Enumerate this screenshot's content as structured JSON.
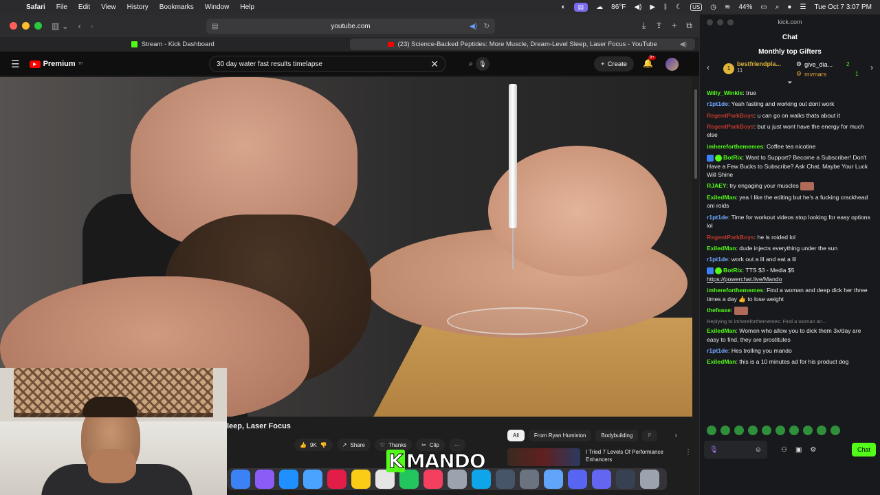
{
  "menubar": {
    "app": "Safari",
    "items": [
      "File",
      "Edit",
      "View",
      "History",
      "Bookmarks",
      "Window",
      "Help"
    ],
    "weather": "86°F",
    "input_source": "US",
    "battery": "44%",
    "datetime": "Tue Oct 7  3:07 PM"
  },
  "safari": {
    "address": "youtube.com",
    "tabs": [
      {
        "label": "Stream - Kick Dashboard"
      },
      {
        "label": "(23) Science-Backed Peptides: More Muscle, Dream-Level Sleep, Laser Focus - YouTube"
      }
    ]
  },
  "youtube": {
    "logo": "Premium",
    "logo_sup": "TH",
    "search_value": "30 day water fast results timelapse",
    "create_label": "Create",
    "notif_badge": "9+",
    "video_title_visible": "leep, Laser Focus",
    "actions": {
      "likes": "9K",
      "share": "Share",
      "thanks": "Thanks",
      "clip": "Clip"
    },
    "chips": [
      "All",
      "From Ryan Humiston",
      "Bodybuilding",
      "P"
    ],
    "rec_title": "I Tried 7 Levels Of Performance Enhancers"
  },
  "overlay": {
    "k": "K",
    "rest": "MANDO"
  },
  "kick": {
    "window_title": "kick.com",
    "header": "Chat",
    "gifters_title": "Monthly top Gifters",
    "top_gifter": {
      "rank": "1",
      "name": "bestfriendpla...",
      "count": "11"
    },
    "gifter2": {
      "name": "give_dia...",
      "count": "2"
    },
    "gifter3": {
      "name": "mvmars",
      "count": "1"
    },
    "messages": [
      {
        "user": "Willy_Winkle",
        "color": "#53fc18",
        "text": "true"
      },
      {
        "user": "r1pt1de",
        "color": "#6fa8ff",
        "text": "Yeah fasting and working out dont work"
      },
      {
        "user": "RegentParkBoys",
        "color": "#c0392b",
        "text": "u can go on walks thats about it"
      },
      {
        "user": "RegentParkBoys",
        "color": "#c0392b",
        "text": "but u just wont have the energy for much else"
      },
      {
        "user": "imhereforthememes",
        "color": "#53fc18",
        "text": "Coffee tea nicotine"
      },
      {
        "user": "BotRix",
        "color": "#53fc18",
        "text": "Want to Support? Become a Subscriber! Don't Have a Few Bucks to Subscribe? Ask Chat, Maybe Your Luck Will Shine"
      },
      {
        "user": "RJAEY",
        "color": "#53fc18",
        "text": "try engaging your muscles"
      },
      {
        "user": "ExiledMan",
        "color": "#53fc18",
        "text": "yea I like the editing but he's a fucking crackhead oni roids"
      },
      {
        "user": "r1pt1de",
        "color": "#6fa8ff",
        "text": "Time for workout videos stop looking for easy options lol"
      },
      {
        "user": "RegentParkBoys",
        "color": "#c0392b",
        "text": "he is roided lol"
      },
      {
        "user": "ExiledMan",
        "color": "#53fc18",
        "text": "dude injects everything under the sun"
      },
      {
        "user": "r1pt1de",
        "color": "#6fa8ff",
        "text": "work out a lil and eat a lil"
      },
      {
        "user": "BotRix",
        "color": "#53fc18",
        "text": "TTS $3 - Media $5",
        "link": "https://powerchat.live/Mando"
      },
      {
        "user": "imhereforthememes",
        "color": "#53fc18",
        "text": "Find a woman and deep dick her three times a day 👍 to lose weight"
      },
      {
        "user": "thefease",
        "color": "#53fc18",
        "text": ""
      },
      {
        "reply": "Replying to imhereforthememes: Find a woman an...",
        "user": "ExiledMan",
        "color": "#53fc18",
        "text": "Women who allow you to dick them 3x/day are easy to find, they are prostitutes"
      },
      {
        "user": "r1pt1de",
        "color": "#6fa8ff",
        "text": "Hes trolling you mando"
      },
      {
        "user": "ExiledMan",
        "color": "#53fc18",
        "text": "this is a 10 minutes ad for his product dog"
      }
    ],
    "chat_button": "Chat"
  }
}
